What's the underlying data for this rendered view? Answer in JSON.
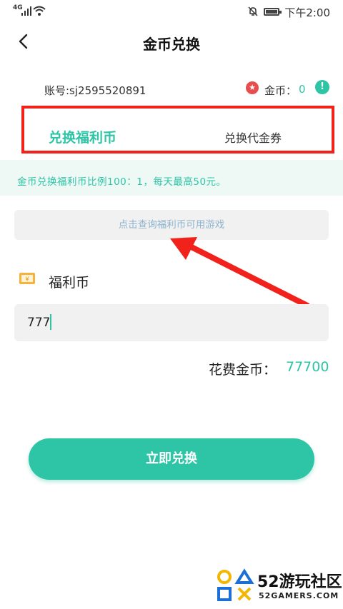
{
  "status_bar": {
    "network": "4G",
    "time": "下午2:00"
  },
  "header": {
    "title": "金币兑换"
  },
  "account": {
    "label": "账号:sj2595520891",
    "coin_label": "金币：",
    "coin_value": "0",
    "info_icon": "!"
  },
  "tabs": [
    {
      "label": "兑换福利币",
      "active": true
    },
    {
      "label": "兑换代金券",
      "active": false
    }
  ],
  "notice": {
    "text": "金币兑换福利币比例100：1，每天最高50元。"
  },
  "query": {
    "text": "点击查询福利币可用游戏"
  },
  "welfare": {
    "label": "福利币"
  },
  "amount": {
    "value": "777"
  },
  "cost": {
    "label": "花费金币：",
    "value": "77700"
  },
  "submit": {
    "label": "立即兑换"
  },
  "watermark": {
    "title": "52游玩社区",
    "subtitle": "52GAMERS.COM"
  },
  "colors": {
    "accent": "#2ec4a6",
    "annotation_red": "#f1221c"
  },
  "icons": [
    "signal-icon",
    "wifi-icon",
    "mute-icon",
    "battery-icon",
    "back-icon",
    "coin-icon",
    "info-icon",
    "welfare-coin-icon"
  ]
}
